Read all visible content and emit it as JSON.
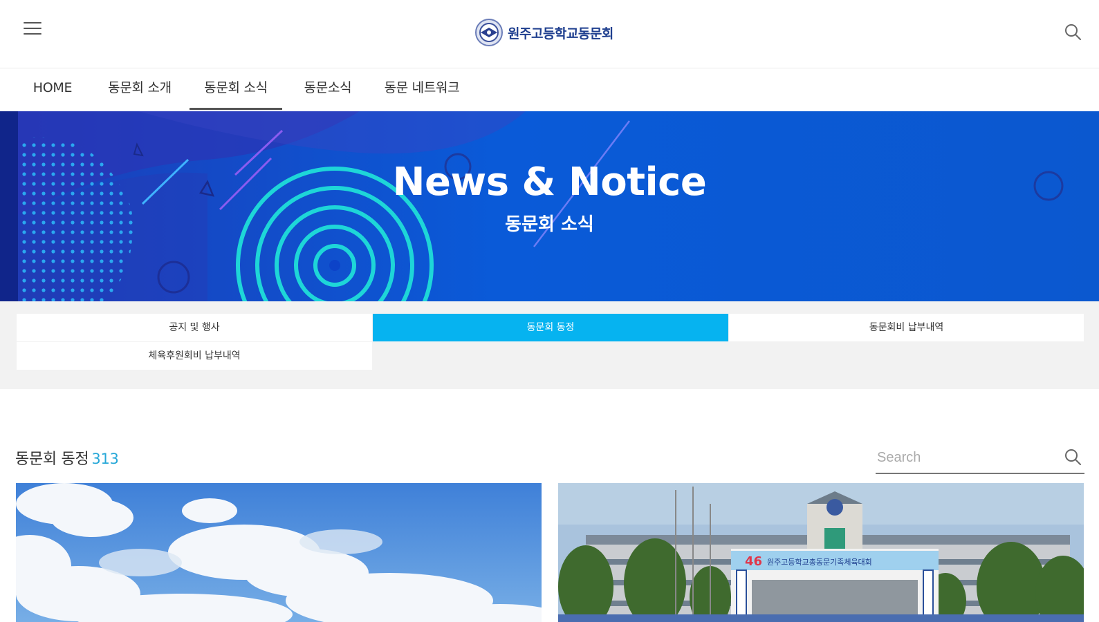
{
  "header": {
    "logo_text": "원주고등학교동문회",
    "menu_icon": "hamburger-menu-icon",
    "search_icon": "search-icon"
  },
  "nav": {
    "items": [
      {
        "label": "HOME"
      },
      {
        "label": "동문회 소개"
      },
      {
        "label": "동문회 소식",
        "active": true
      },
      {
        "label": "동문소식"
      },
      {
        "label": "동문 네트워크"
      }
    ]
  },
  "banner": {
    "title": "News & Notice",
    "subtitle": "동문회 소식"
  },
  "subtabs": [
    {
      "label": "공지 및 행사"
    },
    {
      "label": "동문회 동정",
      "active": true
    },
    {
      "label": "동문회비 납부내역"
    },
    {
      "label": "체육후원회비 납부내역"
    }
  ],
  "section": {
    "title": "동문회 동정",
    "count": "313"
  },
  "search": {
    "placeholder": "Search"
  },
  "cards": {
    "card2_banner_number": "46",
    "card2_banner_text": "원주고등학교총동문기족체육대회"
  },
  "colors": {
    "accent": "#06b3f0",
    "logo_blue": "#1f3f8f",
    "count": "#27a8d8",
    "banner_blue": "#0b4fd6"
  }
}
